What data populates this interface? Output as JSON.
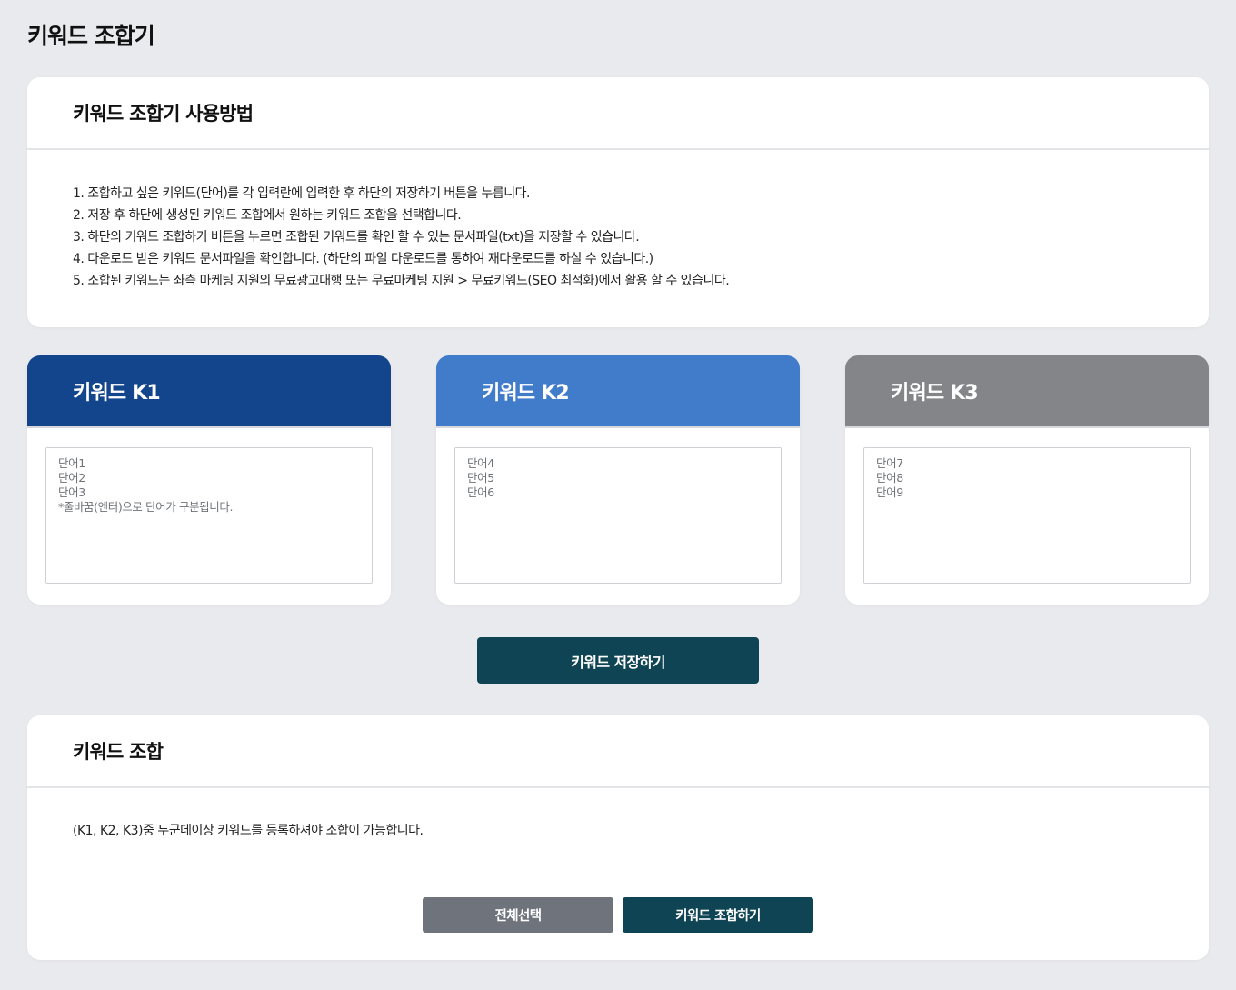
{
  "page": {
    "title": "키워드 조합기"
  },
  "howto": {
    "title": "키워드 조합기 사용방법",
    "steps": [
      "1. 조합하고 싶은 키워드(단어)를 각 입력란에 입력한 후 하단의 저장하기 버튼을 누릅니다.",
      "2. 저장 후 하단에 생성된 키워드 조합에서 원하는 키워드 조합을 선택합니다.",
      "3. 하단의 키워드 조합하기 버튼을 누르면 조합된 키워드를 확인 할 수 있는 문서파일(txt)을 저장할 수 있습니다.",
      "4. 다운로드 받은 키워드 문서파일을 확인합니다. (하단의 파일 다운로드를 통하여 재다운로드를 하실 수 있습니다.)",
      "5. 조합된 키워드는 좌측 마케팅 지원의 무료광고대행 또는 무료마케팅 지원 > 무료키워드(SEO 최적화)에서 활용 할 수 있습니다."
    ]
  },
  "keywords": [
    {
      "title": "키워드 K1",
      "placeholder": "단어1\n단어2\n단어3\n*줄바꿈(엔터)으로 단어가 구분됩니다.",
      "color": "#13458c"
    },
    {
      "title": "키워드 K2",
      "placeholder": "단어4\n단어5\n단어6",
      "color": "#417ccb"
    },
    {
      "title": "키워드 K3",
      "placeholder": "단어7\n단어8\n단어9",
      "color": "#848589"
    }
  ],
  "save_button": {
    "label": "키워드 저장하기"
  },
  "combination": {
    "title": "키워드 조합",
    "note": "(K1, K2, K3)중 두군데이상 키워드를 등록하셔야 조합이 가능합니다.",
    "select_all_label": "전체선택",
    "combine_label": "키워드 조합하기"
  },
  "colors": {
    "background": "#e9eaee",
    "primary_dark": "#0e4453",
    "secondary_gray": "#6f737c"
  }
}
